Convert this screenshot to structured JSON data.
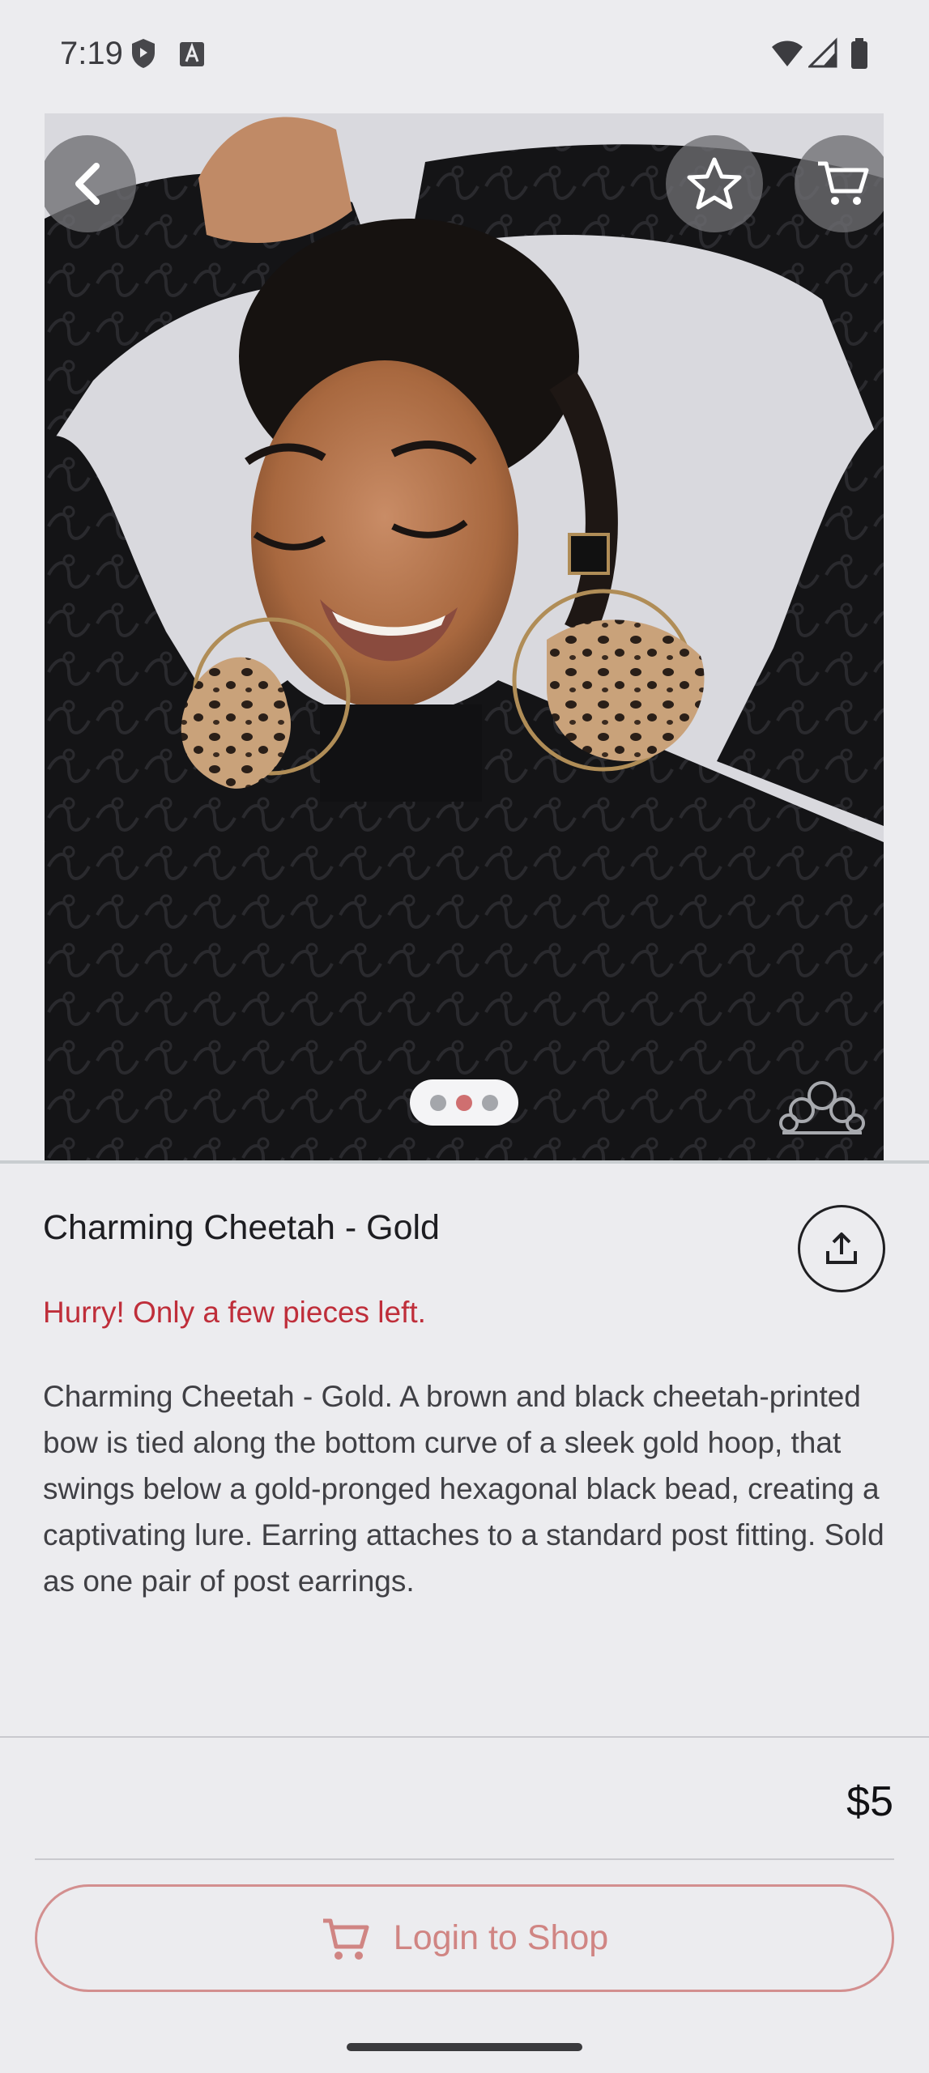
{
  "status_bar": {
    "time": "7:19",
    "left_icons": [
      "shield-icon",
      "keyboard-a-icon"
    ],
    "right_icons": [
      "wifi-icon",
      "signal-icon",
      "battery-icon"
    ]
  },
  "hero": {
    "image": "model-wearing-cheetah-earrings",
    "buttons": [
      "back-arrow-icon",
      "star-icon",
      "cart-icon"
    ],
    "carousel": {
      "total": 3,
      "active_index": 1
    },
    "watermark_icon": "crown-logo-icon"
  },
  "product": {
    "title": "Charming Cheetah - Gold",
    "stock_note": "Hurry! Only a few pieces left.",
    "description": "Charming Cheetah - Gold. A brown and black cheetah-printed bow is tied along the bottom curve of a sleek gold hoop, that swings below a gold-pronged hexagonal black bead, creating a captivating lure. Earring attaches to a standard post fitting. Sold as one pair of post earrings.",
    "price": "$5",
    "share_icon": "share-upload-icon"
  },
  "actions": {
    "login_label": "Login to Shop",
    "login_icon": "cart-icon"
  },
  "colors": {
    "stock_note": "#bf2e3a",
    "accent": "#d08583",
    "background": "#ECECEF"
  }
}
